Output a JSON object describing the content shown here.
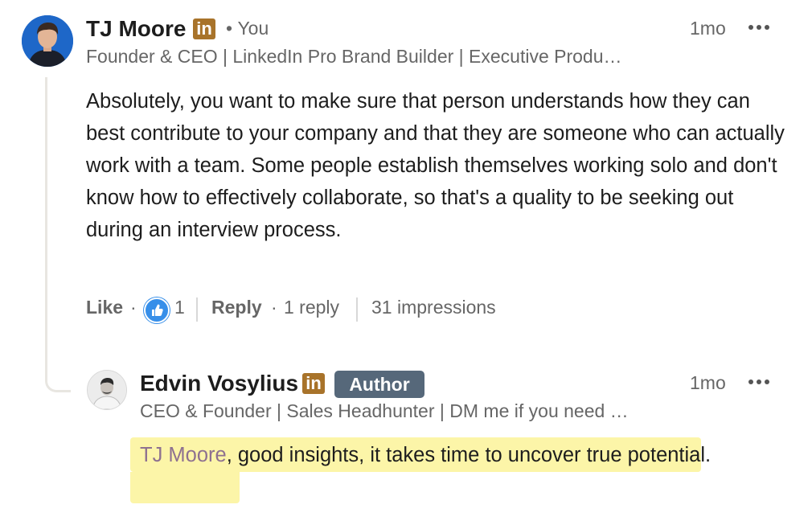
{
  "comment": {
    "author": {
      "name": "TJ Moore",
      "badge": "in",
      "relation": "You",
      "headline": "Founder & CEO | LinkedIn Pro Brand Builder | Executive Produ…",
      "avatar_icon": "profile-photo-icon"
    },
    "time": "1mo",
    "menu_icon": "more-options-icon",
    "text": "Absolutely, you want to make sure that person understands how they can best contribute to your company and that they are someone who can actually work with a team. Some people establish themselves working solo and don't know how to effectively collaborate, so that's a quality to be seeking out during an interview process.",
    "actions": {
      "like_label": "Like",
      "like_count": "1",
      "reply_label": "Reply",
      "reply_count": "1 reply",
      "impressions": "31 impressions"
    }
  },
  "reply": {
    "author": {
      "name": "Edvin Vosylius",
      "badge": "in",
      "author_tag": "Author",
      "headline": "CEO & Founder | Sales Headhunter | DM me if you need …",
      "avatar_icon": "profile-photo-icon"
    },
    "time": "1mo",
    "menu_icon": "more-options-icon",
    "mention": "TJ Moore",
    "text": ", good insights, it takes time to uncover true potential.",
    "highlight_color": "#fcf5a8"
  },
  "colors": {
    "linkedin_badge": "#a8732a",
    "author_tag_bg": "#56687a",
    "like_icon": "#378fe9",
    "mention": "#8e7190"
  }
}
